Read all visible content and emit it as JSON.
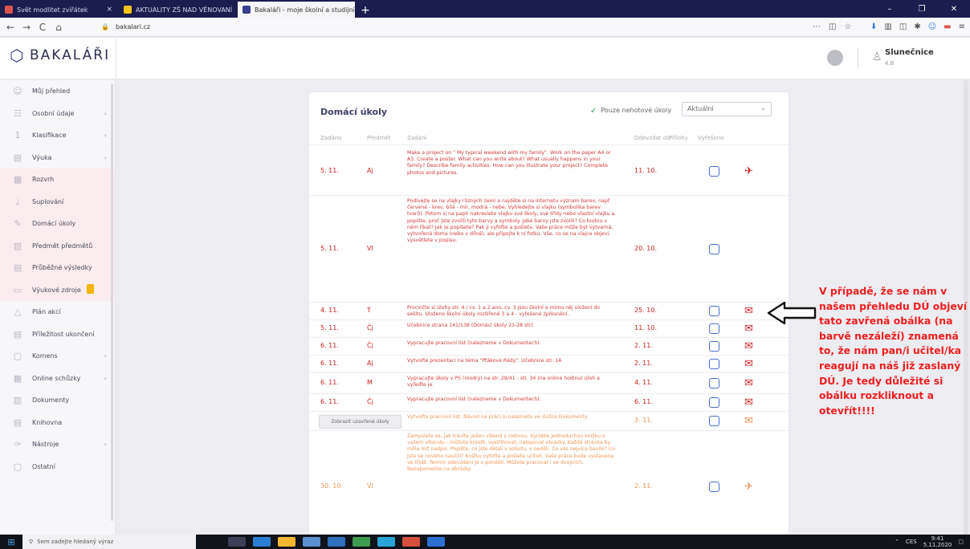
{
  "browser": {
    "tabs": [
      {
        "label": "Svět modlitet zvířátek",
        "color": "#d9534f",
        "active": false
      },
      {
        "label": "AKTUALITY ZŠ NAD VĚNOVANÍ",
        "color": "#f1c40f",
        "active": false
      },
      {
        "label": "Bakaláři - moje školní a studijní",
        "color": "#3a3f8f",
        "active": true
      }
    ],
    "new_tab": "+",
    "window_controls": [
      "–",
      "❐",
      "✕"
    ],
    "url_host": "bakalari.cz",
    "url_lock": "🔒",
    "nav_icons": [
      "←",
      "→",
      "C",
      "⌂"
    ]
  },
  "app": {
    "logo_text": "BAKALÁŘI",
    "user": {
      "name": "Slunečnice",
      "sub": "4.B"
    }
  },
  "sidebar": {
    "items": [
      {
        "label": "Můj přehled",
        "icon": "☺",
        "chevron": false,
        "highlight": false,
        "badge": false
      },
      {
        "label": "Osobní údaje",
        "icon": "☷",
        "chevron": true,
        "highlight": false,
        "badge": false
      },
      {
        "label": "Klasifikace",
        "icon": "1",
        "chevron": true,
        "highlight": false,
        "badge": false
      },
      {
        "label": "Výuka",
        "icon": "▤",
        "chevron": true,
        "highlight": false,
        "badge": false
      },
      {
        "label": "Rozvrh",
        "icon": "▦",
        "chevron": false,
        "highlight": true,
        "badge": false
      },
      {
        "label": "Suplování",
        "icon": "♩",
        "chevron": false,
        "highlight": true,
        "badge": false
      },
      {
        "label": "Domácí úkoly",
        "icon": "✎",
        "chevron": false,
        "highlight": true,
        "badge": false
      },
      {
        "label": "Předmět předmětů",
        "icon": "▥",
        "chevron": false,
        "highlight": true,
        "badge": false
      },
      {
        "label": "Průběžné výsledky",
        "icon": "▤",
        "chevron": false,
        "highlight": true,
        "badge": false
      },
      {
        "label": "Výukové zdroje",
        "icon": "▭",
        "chevron": false,
        "highlight": true,
        "badge": true
      },
      {
        "label": "Plán akcí",
        "icon": "△",
        "chevron": false,
        "highlight": false,
        "badge": false
      },
      {
        "label": "Příležitost ukončení",
        "icon": "▤",
        "chevron": false,
        "highlight": false,
        "badge": false
      },
      {
        "label": "Komens",
        "icon": "▢",
        "chevron": true,
        "highlight": false,
        "badge": false
      },
      {
        "label": "Online schůzky",
        "icon": "▦",
        "chevron": true,
        "highlight": false,
        "badge": false
      },
      {
        "label": "Dokumenty",
        "icon": "▥",
        "chevron": false,
        "highlight": false,
        "badge": false
      },
      {
        "label": "Knihovna",
        "icon": "▤",
        "chevron": false,
        "highlight": false,
        "badge": false
      },
      {
        "label": "Nástroje",
        "icon": "✑",
        "chevron": true,
        "highlight": false,
        "badge": false
      },
      {
        "label": "Ostatní",
        "icon": "▢",
        "chevron": false,
        "highlight": false,
        "badge": false
      }
    ]
  },
  "homework": {
    "title": "Domácí úkoly",
    "show_closed": "Pouze nehotové úkoly",
    "filter_value": "Aktuální",
    "headers": [
      "Zadáno",
      "Předmět",
      "Zadání",
      "Odevzdat do",
      "Přílohy",
      "Vyřešeno"
    ],
    "rows": [
      {
        "date": "5. 11.",
        "subject": "Aj",
        "task": "Make a project on \" My typical weekend with my family\". Work on the paper A4 or A3. Create a poster. What can you write about? What usually happens in your family? Describe family activities. How can you illustrate your project? Complete photos and pictures.",
        "due": "11. 10.",
        "env": "✈",
        "env_color": "#c22",
        "orange": false
      },
      {
        "date": "5. 11.",
        "subject": "Vl",
        "task": "Podívejte se na vlajky různých zemí a najděte si na internetu význam barev, např. červená - krev, bílá - mír, modrá - nebe. Vyhledejte si vlajku (symbolika barev tvarů). Potom si na papír nakreslete vlajku své školy, své třídy nebo vlastní vlajku a popište, proč jste zvolili tyto barvy a symboly. Jaké barvy jste zvolili? Co budou v něm říkat? Jak je popíšete? Pak ji vyfoťte a pošlete. Vaše práce může být výtvarná, vytvořená doma (nebo v dílně), ale připojte k ní fotku. Vše, co se na vlajce objeví, vysvětlete v popisu.",
        "due": "20. 10.",
        "env": "",
        "env_color": "#c22",
        "orange": false
      },
      {
        "date": "4. 11.",
        "subject": "T",
        "task": "Procvičte si úlohy str. 4 / cv. 1 a 2 ano, cv. 3 jsou školní a mimo něj vložení do sešitu. Uloženo školní úkoly rozšířené 3 a 4 - vyřešené zpřesnění.",
        "due": "25. 10.",
        "env": "✉",
        "env_color": "#c22",
        "orange": false
      },
      {
        "date": "5. 11.",
        "subject": "Čj",
        "task": "Učebnice strana 141/138 (Domácí úkoly 23-28 str).",
        "due": "11. 10.",
        "env": "✉",
        "env_color": "#c22",
        "orange": false
      },
      {
        "date": "6. 11.",
        "subject": "Čj",
        "task": "Vypracujte pracovní list (nalezneme v Dokumentech).",
        "due": "2. 11.",
        "env": "✉",
        "env_color": "#c22",
        "orange": false
      },
      {
        "date": "6. 11.",
        "subject": "Aj",
        "task": "Vytvořte prezentaci na téma \"Pťákové Řády\". Učebnice str. 14.",
        "due": "2. 11.",
        "env": "✉",
        "env_color": "#c22",
        "orange": false
      },
      {
        "date": "6. 11.",
        "subject": "M",
        "task": "Vypracujte úkoly v PS (modrý) na str. 28/41 - str. 34 (na online hodinu) úloh a vyřeďte je.",
        "due": "4. 11.",
        "env": "✉",
        "env_color": "#c22",
        "orange": false
      },
      {
        "date": "6. 11.",
        "subject": "Čj",
        "task": "Vypracujte pracovní list (nalezneme v Dokumentech).",
        "due": "6. 11.",
        "env": "✉",
        "env_color": "#c22",
        "orange": false
      },
      {
        "date": "",
        "subject": "",
        "task": "Vytvořte pracovní list. Návod na práci si naleznete ve složce Dokumenty.",
        "due": "3. 11.",
        "env": "✉",
        "env_color": "#f0955a",
        "orange": true,
        "closed_button": "Zobrazit uzavřené úkoly"
      },
      {
        "date": "30. 10.",
        "subject": "Vl",
        "task": "Zamyslete se, jak trávíte jeden víkend s rodinou. Vyrobte jednoduchou knížku o vašem víkendu - můžete kreslit, vystřihovat, nalepovat obrázky. Každá stránka by měla mít nadpis. Popište, co jste dělali v sobotu, v neděli. Co vás nejvíce bavilo? Co jste se nového naučili? Knížku vyfoťte a pošlete učiteli. Vaše práce bude vystavena ve třídě. Termín odevzdání je v pondělí. Můžete pracovat i ve dvojicích. Nezapomeňte na obrázky.",
        "due": "2. 11.",
        "env": "✈",
        "env_color": "#f0955a",
        "orange": true
      }
    ]
  },
  "annotation": {
    "text": "V případě, že se nám v našem přehledu DÚ objeví tato zavřená obálka (na barvě nezáleží) znamená to, že nám pan/i učitel/ka reagují na náš již zaslaný DÚ. Je tedy důležité si obálku rozkliknout a otevřít!!!!"
  },
  "taskbar": {
    "search_placeholder": "Sem zadejte hledaný výraz",
    "time": "9:41",
    "date": "5.11.2020",
    "lang": "CES"
  }
}
